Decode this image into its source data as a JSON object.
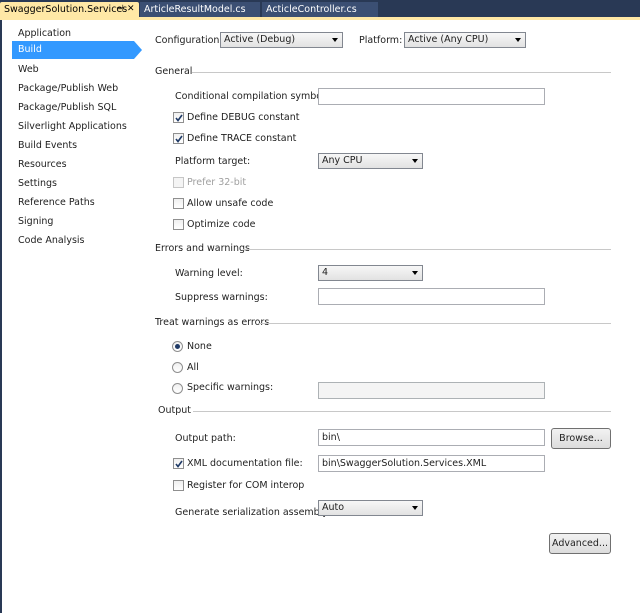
{
  "tabs": [
    {
      "label": "SwaggerSolution.Services",
      "pin": "⊣",
      "close": "✕"
    },
    {
      "label": "ArticleResultModel.cs"
    },
    {
      "label": "ActicleController.cs"
    }
  ],
  "sidebar": {
    "items": [
      {
        "label": "Application"
      },
      {
        "label": "Build"
      },
      {
        "label": "Web"
      },
      {
        "label": "Package/Publish Web"
      },
      {
        "label": "Package/Publish SQL"
      },
      {
        "label": "Silverlight Applications"
      },
      {
        "label": "Build Events"
      },
      {
        "label": "Resources"
      },
      {
        "label": "Settings"
      },
      {
        "label": "Reference Paths"
      },
      {
        "label": "Signing"
      },
      {
        "label": "Code Analysis"
      }
    ],
    "selected": "Build"
  },
  "header": {
    "configuration_label": "Configuration:",
    "configuration_value": "Active (Debug)",
    "platform_label": "Platform:",
    "platform_value": "Active (Any CPU)"
  },
  "general": {
    "title": "General",
    "symbols_label": "Conditional compilation symbols:",
    "symbols_value": "",
    "debug_label": "Define DEBUG constant",
    "debug_checked": true,
    "trace_label": "Define TRACE constant",
    "trace_checked": true,
    "platform_target_label": "Platform target:",
    "platform_target_value": "Any CPU",
    "prefer32_label": "Prefer 32-bit",
    "prefer32_checked": false,
    "unsafe_label": "Allow unsafe code",
    "unsafe_checked": false,
    "optimize_label": "Optimize code",
    "optimize_checked": false
  },
  "errors": {
    "title": "Errors and warnings",
    "warning_level_label": "Warning level:",
    "warning_level_value": "4",
    "suppress_label": "Suppress warnings:",
    "suppress_value": ""
  },
  "treat": {
    "title": "Treat warnings as errors",
    "none_label": "None",
    "all_label": "All",
    "specific_label": "Specific warnings:",
    "selected": "None",
    "specific_value": ""
  },
  "output": {
    "title": "Output",
    "path_label": "Output path:",
    "path_value": "bin\\",
    "browse_label": "Browse...",
    "xml_label": "XML documentation file:",
    "xml_checked": true,
    "xml_value": "bin\\SwaggerSolution.Services.XML",
    "com_label": "Register for COM interop",
    "com_checked": false,
    "serialization_label": "Generate serialization assembly:",
    "serialization_value": "Auto",
    "advanced_label": "Advanced..."
  }
}
